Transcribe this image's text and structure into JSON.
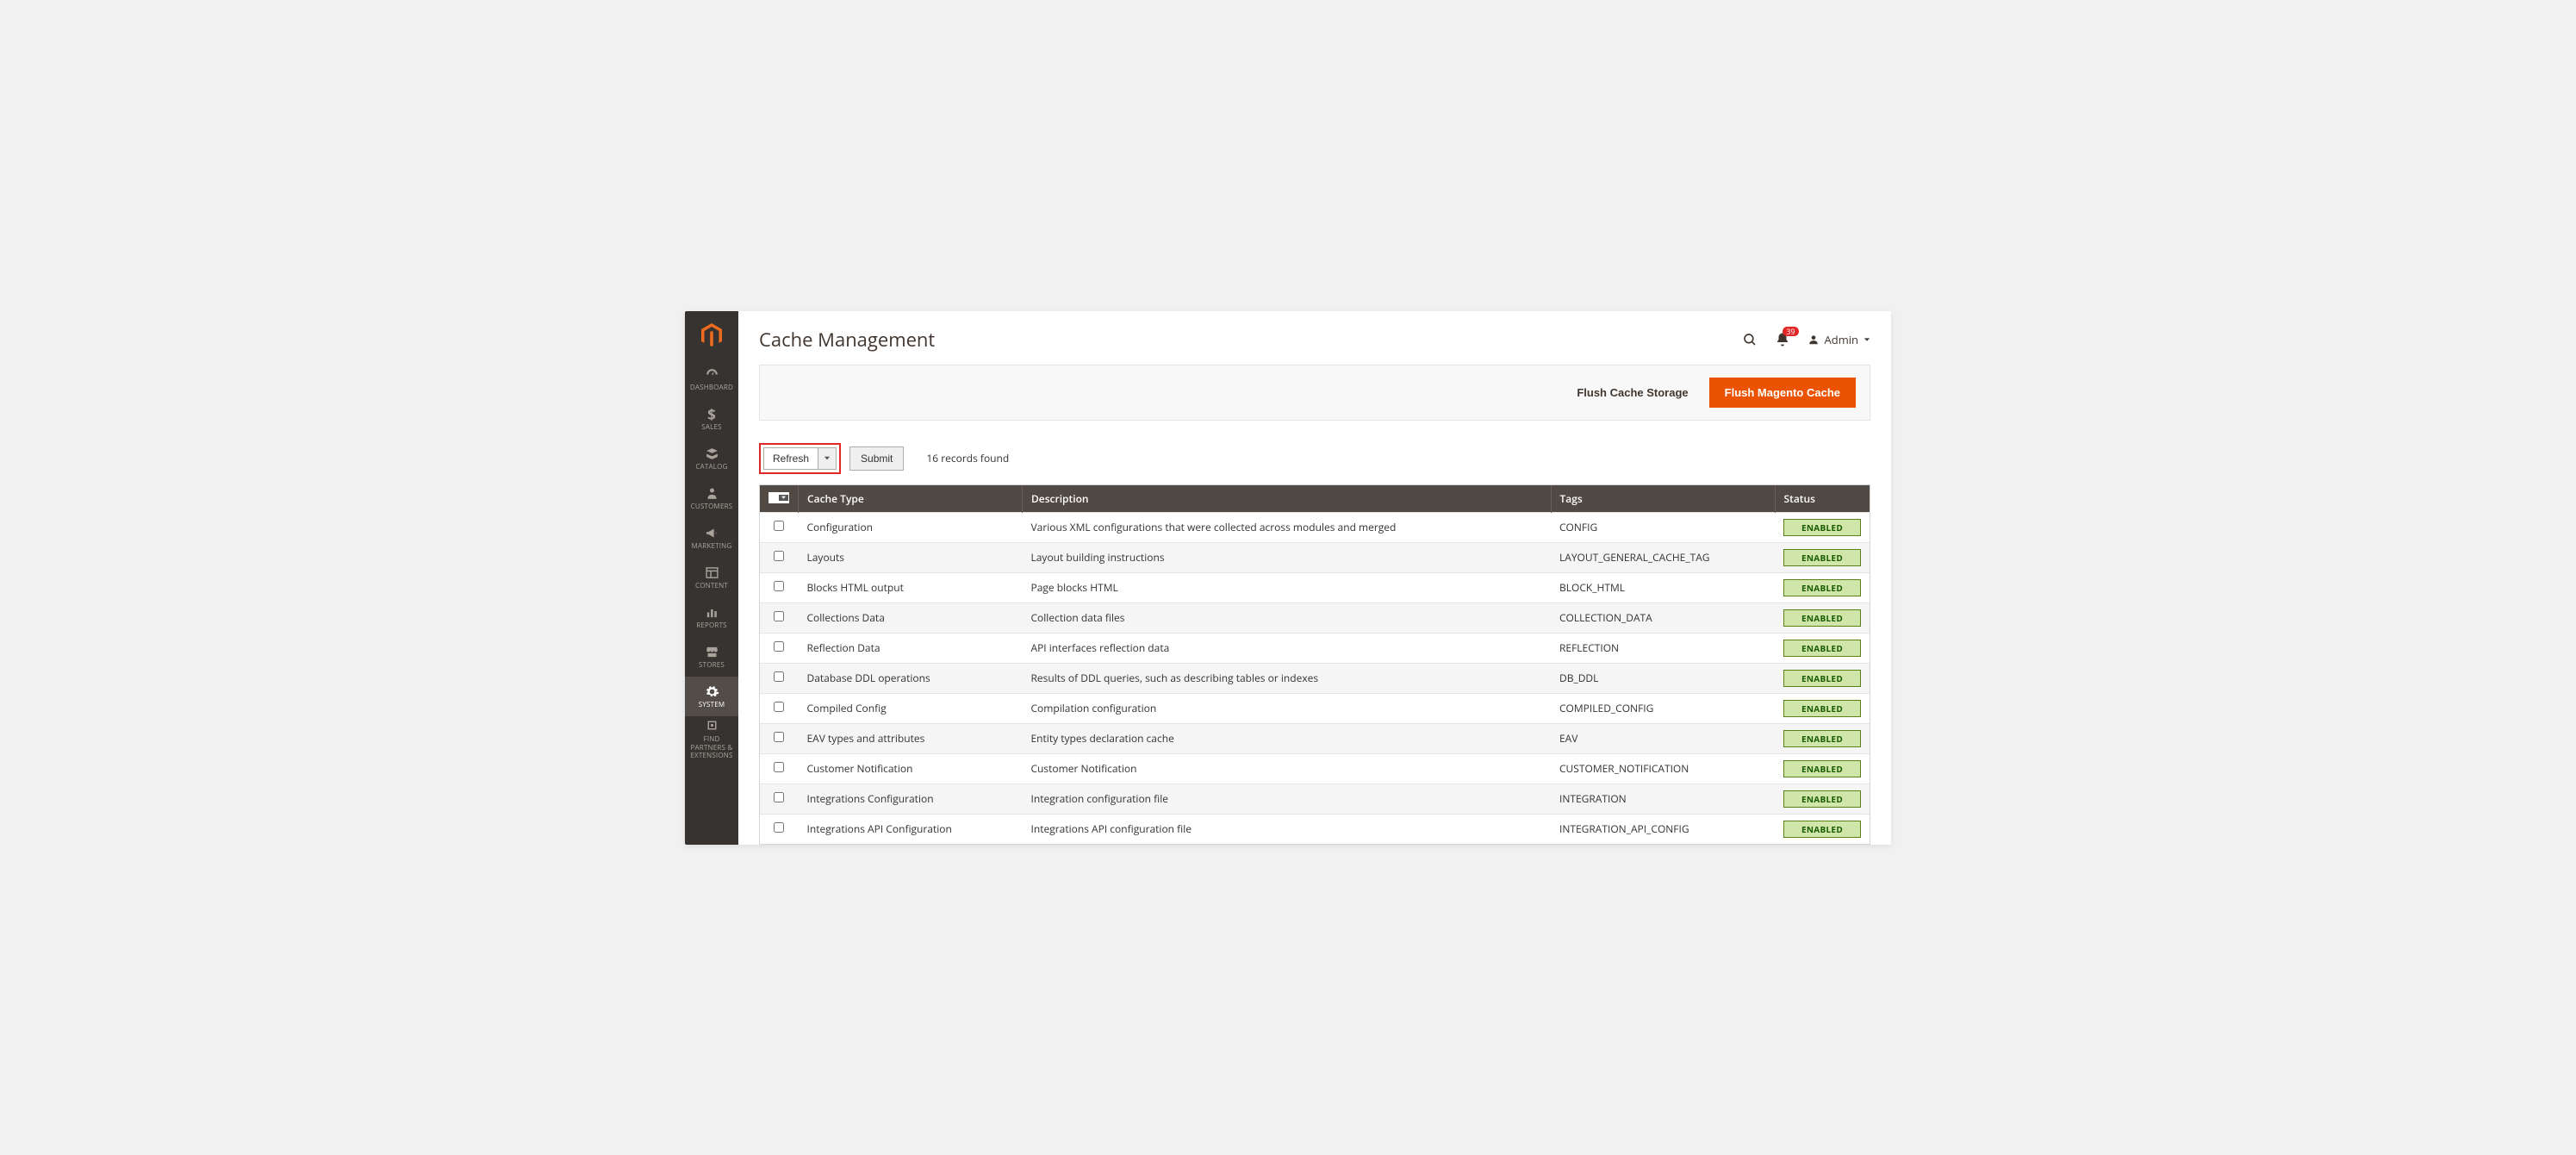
{
  "header": {
    "page_title": "Cache Management",
    "notification_count": "39",
    "admin_label": "Admin"
  },
  "sidebar": {
    "items": [
      {
        "label": "DASHBOARD",
        "icon": "dashboard"
      },
      {
        "label": "SALES",
        "icon": "sales"
      },
      {
        "label": "CATALOG",
        "icon": "catalog"
      },
      {
        "label": "CUSTOMERS",
        "icon": "customers"
      },
      {
        "label": "MARKETING",
        "icon": "marketing"
      },
      {
        "label": "CONTENT",
        "icon": "content"
      },
      {
        "label": "REPORTS",
        "icon": "reports"
      },
      {
        "label": "STORES",
        "icon": "stores"
      },
      {
        "label": "SYSTEM",
        "icon": "system"
      },
      {
        "label": "FIND PARTNERS & EXTENSIONS",
        "icon": "partners"
      }
    ]
  },
  "actions": {
    "flush_storage": "Flush Cache Storage",
    "flush_magento": "Flush Magento Cache",
    "refresh": "Refresh",
    "submit": "Submit",
    "records_found": "16 records found"
  },
  "table": {
    "headers": {
      "cache_type": "Cache Type",
      "description": "Description",
      "tags": "Tags",
      "status": "Status"
    },
    "rows": [
      {
        "type": "Configuration",
        "desc": "Various XML configurations that were collected across modules and merged",
        "tags": "CONFIG",
        "status": "ENABLED"
      },
      {
        "type": "Layouts",
        "desc": "Layout building instructions",
        "tags": "LAYOUT_GENERAL_CACHE_TAG",
        "status": "ENABLED"
      },
      {
        "type": "Blocks HTML output",
        "desc": "Page blocks HTML",
        "tags": "BLOCK_HTML",
        "status": "ENABLED"
      },
      {
        "type": "Collections Data",
        "desc": "Collection data files",
        "tags": "COLLECTION_DATA",
        "status": "ENABLED"
      },
      {
        "type": "Reflection Data",
        "desc": "API interfaces reflection data",
        "tags": "REFLECTION",
        "status": "ENABLED"
      },
      {
        "type": "Database DDL operations",
        "desc": "Results of DDL queries, such as describing tables or indexes",
        "tags": "DB_DDL",
        "status": "ENABLED"
      },
      {
        "type": "Compiled Config",
        "desc": "Compilation configuration",
        "tags": "COMPILED_CONFIG",
        "status": "ENABLED"
      },
      {
        "type": "EAV types and attributes",
        "desc": "Entity types declaration cache",
        "tags": "EAV",
        "status": "ENABLED"
      },
      {
        "type": "Customer Notification",
        "desc": "Customer Notification",
        "tags": "CUSTOMER_NOTIFICATION",
        "status": "ENABLED"
      },
      {
        "type": "Integrations Configuration",
        "desc": "Integration configuration file",
        "tags": "INTEGRATION",
        "status": "ENABLED"
      },
      {
        "type": "Integrations API Configuration",
        "desc": "Integrations API configuration file",
        "tags": "INTEGRATION_API_CONFIG",
        "status": "ENABLED"
      }
    ]
  }
}
